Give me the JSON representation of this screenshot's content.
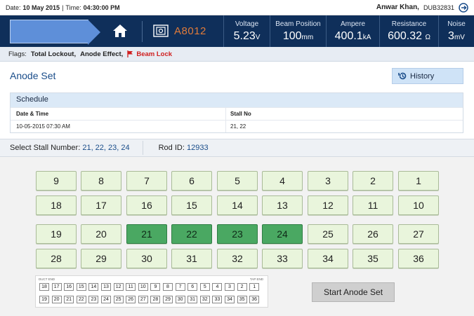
{
  "topbar": {
    "date_label": "Date:",
    "date_value": "10 May 2015",
    "divider": "|",
    "time_label": "Time:",
    "time_value": "04:30:00 PM",
    "user_name": "Anwar Khan,",
    "user_id": "DUB32831"
  },
  "nav": {
    "pot_label": "A8012",
    "metrics": [
      {
        "label": "Voltage",
        "value": "5.23",
        "unit": "V"
      },
      {
        "label": "Beam Position",
        "value": "100",
        "unit": "mm"
      },
      {
        "label": "Ampere",
        "value": "400.1",
        "unit": "kA"
      },
      {
        "label": "Resistance",
        "value": "600.32",
        "unit": "Ω"
      },
      {
        "label": "Noise",
        "value": "3",
        "unit": "mV"
      }
    ]
  },
  "flags": {
    "label": "Flags:",
    "items": [
      "Total Lockout,",
      "Anode Effect,"
    ],
    "alert": "Beam Lock"
  },
  "section": {
    "title": "Anode Set",
    "history_label": "History"
  },
  "schedule": {
    "title": "Schedule",
    "columns": [
      "Date & Time",
      "Stall No"
    ],
    "rows": [
      [
        "10-05-2015 07:30 AM",
        "21, 22"
      ]
    ]
  },
  "selection": {
    "stall_label": "Select Stall Number:",
    "stall_value": "21, 22, 23, 24",
    "rod_label": "Rod ID:",
    "rod_value": "12933"
  },
  "stalls": {
    "rows": [
      [
        "9",
        "8",
        "7",
        "6",
        "5",
        "4",
        "3",
        "2",
        "1"
      ],
      [
        "18",
        "17",
        "16",
        "15",
        "14",
        "13",
        "12",
        "11",
        "10"
      ],
      [
        "19",
        "20",
        "21",
        "22",
        "23",
        "24",
        "25",
        "26",
        "27"
      ],
      [
        "28",
        "29",
        "30",
        "31",
        "32",
        "33",
        "34",
        "35",
        "36"
      ]
    ],
    "selected": [
      "21",
      "22",
      "23",
      "24"
    ]
  },
  "mini_map": {
    "left_label": "DUCT END",
    "right_label": "TAP END",
    "rows": [
      [
        "18",
        "17",
        "16",
        "15",
        "14",
        "13",
        "12",
        "11",
        "10",
        "9",
        "8",
        "7",
        "6",
        "5",
        "4",
        "3",
        "2",
        "1"
      ],
      [
        "19",
        "20",
        "21",
        "22",
        "23",
        "24",
        "25",
        "26",
        "27",
        "28",
        "29",
        "30",
        "31",
        "32",
        "33",
        "34",
        "35",
        "36"
      ]
    ]
  },
  "actions": {
    "start_label": "Start Anode Set"
  },
  "colors": {
    "navy": "#0f2f5a",
    "accent_orange": "#e07b3a",
    "stall_idle": "#e9f5dc",
    "stall_selected": "#4aa862",
    "alert_red": "#d01f1f"
  }
}
